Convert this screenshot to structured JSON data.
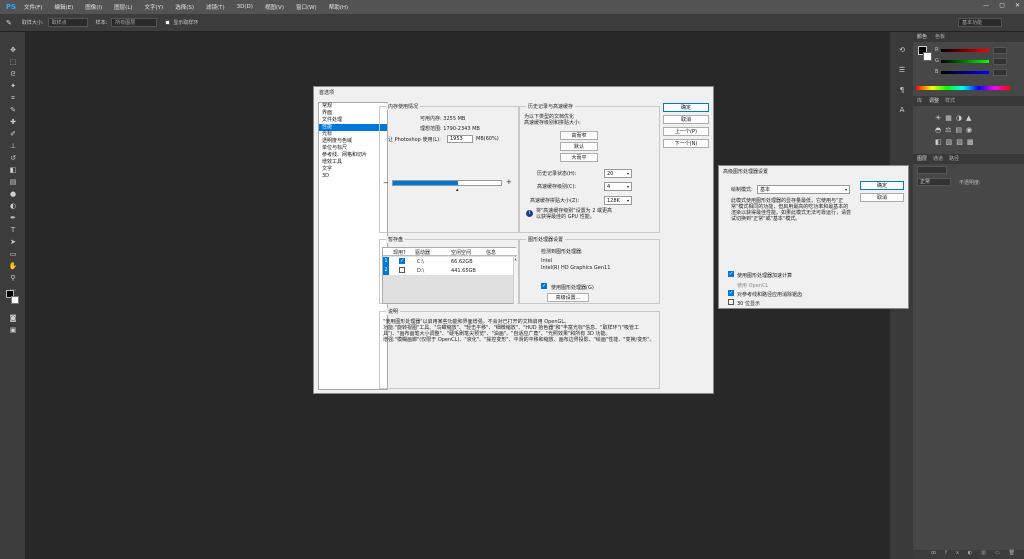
{
  "app": {
    "logo": "PS",
    "menu": [
      "文件(F)",
      "编辑(E)",
      "图像(I)",
      "图层(L)",
      "文字(Y)",
      "选择(S)",
      "滤镜(T)",
      "3D(D)",
      "视图(V)",
      "窗口(W)",
      "帮助(H)"
    ],
    "window_buttons": [
      "—",
      "▢",
      "✕"
    ]
  },
  "options_bar": {
    "size_label": "取样大小:",
    "size_value": "取样点",
    "sample_label": "样本:",
    "sample_value": "所有图层",
    "show_ring": "显示取样环",
    "workspace": "基本功能"
  },
  "panels": {
    "color_tabs": [
      "颜色",
      "色板"
    ],
    "channels": [
      "R",
      "G",
      "B"
    ],
    "adjust_tabs": [
      "库",
      "调整",
      "样式"
    ],
    "layer_tabs": [
      "图层",
      "通道",
      "路径"
    ],
    "layer_mode": "正常",
    "opacity_label": "不透明度:"
  },
  "prefs": {
    "title": "首选项",
    "nav": [
      "常规",
      "界面",
      "文件处理",
      "性能",
      "光标",
      "透明度与色域",
      "单位与标尺",
      "参考线、网格和切片",
      "增效工具",
      "文字",
      "3D"
    ],
    "nav_selected": 3,
    "memory": {
      "title": "内存使用情况",
      "available": "可用内存:  3255 MB",
      "ideal": "理想范围:  1790-2343 MB",
      "ps_label": "让 Photoshop 使用(L):",
      "ps_value": "1953",
      "ps_unit": "MB(60%)",
      "minus": "−",
      "plus": "+",
      "slider_fraction": 0.6
    },
    "history": {
      "title": "历史记录与高速缓存",
      "optimize_text": "为以下类型的文档优化\n高速缓存级别和拼贴大小:",
      "btn_tall": "高而窄",
      "btn_default": "默认",
      "btn_large": "大而平",
      "states_label": "历史记录状态(H):",
      "states_value": "20",
      "levels_label": "高速缓存级别(C):",
      "levels_value": "4",
      "tile_label": "高速缓存拼贴大小(Z):",
      "tile_value": "128K",
      "info": "将\"高速缓存级别\"设置为 2 或更高以获得最佳的 GPU 性能。"
    },
    "scratch": {
      "title": "暂存盘",
      "headers": [
        "现用?",
        "驱动器",
        "空闲空间",
        "信息"
      ],
      "rows": [
        {
          "num": "1",
          "active": true,
          "drive": "C:\\",
          "free": "66.62GB",
          "info": ""
        },
        {
          "num": "2",
          "active": false,
          "drive": "D:\\",
          "free": "441.65GB",
          "info": ""
        }
      ]
    },
    "gpu": {
      "title": "图形处理器设置",
      "detected_label": "检测到图形处理器:",
      "vendor": "Intel",
      "model": "Intel(R) HD Graphics Gen11",
      "use_gpu": "使用图形处理器(G)",
      "advanced_btn": "高级设置..."
    },
    "description": {
      "title": "说明",
      "text": "\"使用图形处理器\"以启用某些功能和界面增强。不会对已打开的文档启用 OpenGL。\n功能:\"旋转视图\"工具、\"鸟瞰缩放\"、\"轻击平移\"、\"细微缩放\"、\"HUD 拾色器\"和\"丰富光标\"信息、\"取样环\"(\"吸管工具\")、\"画布画笔大小调整\"、\"硬毛刷笔尖预览\"、\"油画\"、\"自适应广角\"、\"光照效果\"和所有 3D 功能。\n增强:\"模糊画廊\"(仅限于 OpenCL)、\"液化\"、\"操控变形\"、平滑的平移和缩放、画布边界投影、\"绘画\"性能、\"变换/变形\"。"
    },
    "buttons": [
      "确定",
      "取消",
      "上一个(P)",
      "下一个(N)"
    ]
  },
  "advanced": {
    "title": "高级图形处理器设置",
    "mode_label": "绘制模式:",
    "mode_value": "基本",
    "ok": "确定",
    "cancel": "取消",
    "desc": "此模式使用图形处理器的显存量最低，它使用与\"正常\"模式相同的功能，但启用最高的吃功率和最基本的渲染以获得最佳性能。如果此模式无法可靠运行，请尝试切换到\"正常\"或\"基本\"模式。",
    "use_gpu_calc": "使用图形处理器加速计算",
    "use_opencl": "使用 OpenCL",
    "antialias": "对参考线和路径应用消除锯齿",
    "ten_bit": "30 位显示"
  }
}
